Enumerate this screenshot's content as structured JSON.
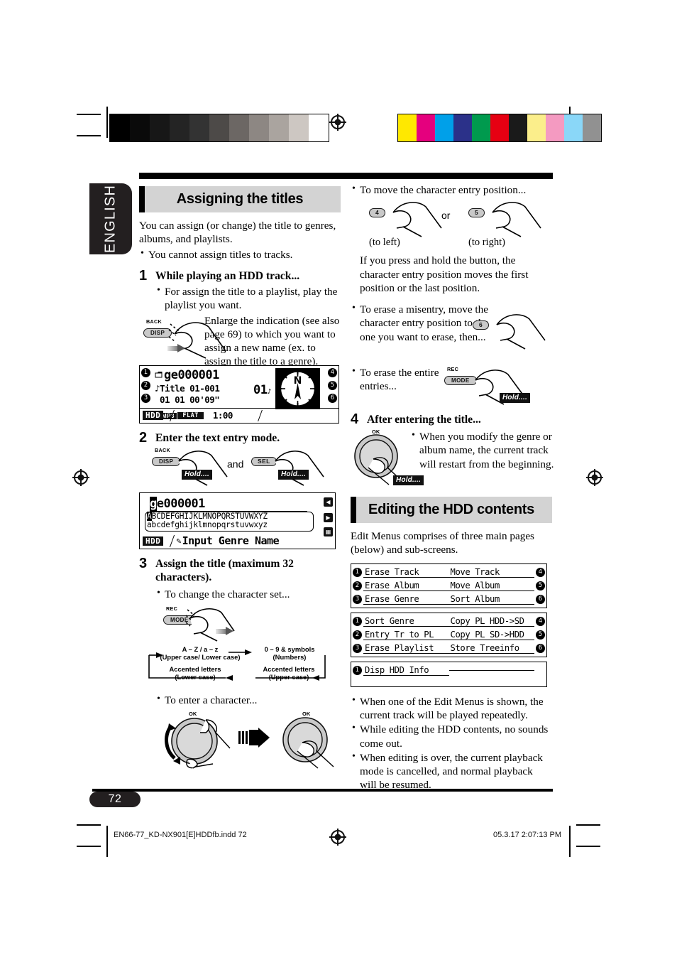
{
  "page": {
    "language_tab": "ENGLISH",
    "page_number": "72",
    "footer_left": "EN66-77_KD-NX901[E]HDDfb.indd   72",
    "footer_right": "05.3.17   2:07:13 PM"
  },
  "left_column": {
    "section_title": "Assigning the titles",
    "intro": "You can assign (or change) the title to genres, albums, and playlists.",
    "intro_bullet": "You cannot assign titles to tracks.",
    "step1": {
      "number": "1",
      "title": "While playing an HDD track...",
      "bullet": "For assign the title to a playlist, play the playlist you want.",
      "button": {
        "label_top": "BACK",
        "label_main": "DISP"
      },
      "description": "Enlarge the indication (see also page 69) to which you want to assign a new name (ex. to assign the title to a genre)."
    },
    "lcd_playback": {
      "left_pills": [
        "1",
        "2",
        "3"
      ],
      "right_pills": [
        "4",
        "5",
        "6"
      ],
      "line1": "ge000001",
      "line2": "Title 01-001",
      "line3": "01  01  00'09\"",
      "track_big": "01",
      "format_tag": "MP3",
      "source_tag": "HDD",
      "eq_tag": "FLAT",
      "clock": "1:00",
      "compass_letter": "N"
    },
    "step2": {
      "number": "2",
      "title": "Enter the text entry mode.",
      "button_a": {
        "label_top": "BACK",
        "label_main": "DISP"
      },
      "conjunction": "and",
      "button_b": {
        "label_main": "SEL"
      },
      "hold_a": "Hold....",
      "hold_b": "Hold...."
    },
    "lcd_entry": {
      "title_value": "ge000001",
      "cursor_char": "g",
      "charset_upper": "ABCDEFGHIJKLMNOPQRSTUVWXYZ",
      "charset_lower": "abcdefghijklmnopqrstuvwxyz",
      "selected_char": "A",
      "source_tag": "HDD",
      "prompt": "Input Genre Name",
      "side_icons": [
        "left-arrow-icon",
        "right-arrow-icon",
        "erase-icon"
      ]
    },
    "step3": {
      "number": "3",
      "title": "Assign the title (maximum 32 characters).",
      "bullet_charset": "To change the character set...",
      "button": {
        "label_top": "REC",
        "label_main": "MODE"
      },
      "cycle": [
        {
          "main": "A – Z / a – z",
          "sub": "(Upper case/ Lower case)"
        },
        {
          "main": "0 – 9 & symbols",
          "sub": "(Numbers)"
        },
        {
          "main": "Accented letters",
          "sub": "(Upper case)"
        },
        {
          "main": "Accented letters",
          "sub": "(Lower case)"
        }
      ],
      "bullet_enter": "To enter a character...",
      "dial_label": "OK"
    }
  },
  "right_column": {
    "bullet_move": "To move the character entry position...",
    "button_left": {
      "label_main": "4",
      "caption": "(to left)"
    },
    "conjunction": "or",
    "button_right": {
      "label_main": "5",
      "caption": "(to right)"
    },
    "paragraph_hold": "If you press and hold the button, the character entry position moves the first position or the last position.",
    "bullet_erase": "To erase a misentry, move the character entry position to the one you want to erase, then...",
    "button_erase": {
      "label_main": "6"
    },
    "bullet_erase_all": "To erase the entire entries...",
    "button_erase_all": {
      "label_top": "REC",
      "label_main": "MODE"
    },
    "hold_erase_all": "Hold....",
    "step4": {
      "number": "4",
      "title": "After entering the title...",
      "dial_label": "OK",
      "hold": "Hold....",
      "bullet": "When you modify the genre or album name, the current track will restart from the beginning."
    },
    "section_title": "Editing the HDD contents",
    "intro": "Edit Menus comprises of three main pages (below) and sub-screens.",
    "edit_menus": [
      {
        "rows": [
          {
            "left_num": "1",
            "left": "Erase Track",
            "right": "Move Track",
            "right_num": "4"
          },
          {
            "left_num": "2",
            "left": "Erase Album",
            "right": "Move Album",
            "right_num": "5"
          },
          {
            "left_num": "3",
            "left": "Erase Genre",
            "right": "Sort Album",
            "right_num": "6"
          }
        ]
      },
      {
        "rows": [
          {
            "left_num": "1",
            "left": "Sort Genre",
            "right": "Copy PL HDD->SD",
            "right_num": "4"
          },
          {
            "left_num": "2",
            "left": "Entry Tr to PL",
            "right": "Copy PL SD->HDD",
            "right_num": "5"
          },
          {
            "left_num": "3",
            "left": "Erase Playlist",
            "right": "Store Treeinfo",
            "right_num": "6"
          }
        ]
      },
      {
        "rows": [
          {
            "left_num": "1",
            "left": "Disp HDD Info",
            "right": "",
            "right_num": ""
          }
        ]
      }
    ],
    "notes": [
      "When one of the Edit Menus is shown, the current track will be played repeatedly.",
      "While editing the HDD contents, no sounds come out.",
      "When editing is over, the current playback mode is cancelled, and normal playback will be resumed."
    ]
  },
  "print_marks": {
    "gray_swatches": [
      "#000000",
      "#0a0a0a",
      "#171717",
      "#242424",
      "#333333",
      "#4d4a48",
      "#6c6764",
      "#8d8783",
      "#aaa49f",
      "#cdc7c2",
      "#ffffff"
    ],
    "color_swatches": [
      "#ffe800",
      "#e5007e",
      "#00a0e9",
      "#2b3189",
      "#009a4e",
      "#e60012",
      "#1a1a1a",
      "#fbee8b",
      "#f49ac1",
      "#8ad7f8",
      "#919191"
    ]
  }
}
